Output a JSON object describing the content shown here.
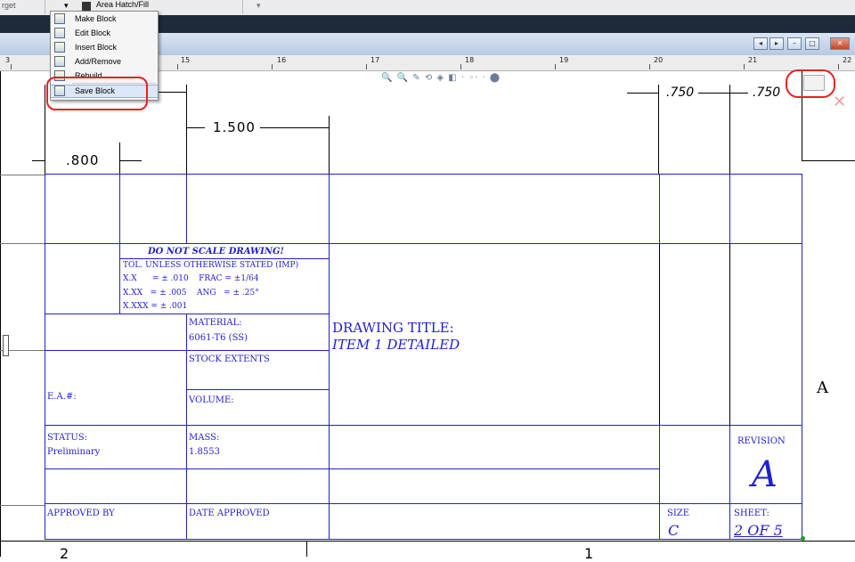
{
  "toolbar": {
    "left_label": "rget",
    "area_hatch": "Area Hatch/Fill",
    "sep_glyph": "▾"
  },
  "window_buttons": {
    "b1": "◂",
    "b2": "▸",
    "min": "–",
    "max": "□",
    "close": "✕"
  },
  "ruler": {
    "numbers": [
      "15",
      "16",
      "17",
      "18",
      "19",
      "20",
      "21",
      "22"
    ],
    "left_num": "3"
  },
  "menu": {
    "items": [
      {
        "label": "Make Block",
        "icon": "make-block-icon"
      },
      {
        "label": "Edit Block",
        "icon": "edit-block-icon"
      },
      {
        "label": "Insert Block",
        "icon": "insert-block-icon"
      },
      {
        "label": "Add/Remove",
        "icon": "add-remove-icon"
      },
      {
        "label": "Rebuild",
        "icon": "rebuild-icon"
      },
      {
        "label": "Save Block",
        "icon": "save-block-icon"
      }
    ]
  },
  "view_toolbar": "🔍 🔍 ✎ ⟲ ◈ ◧ · ◦· · ⬤",
  "dims": {
    "d750a": ".750",
    "d750b": ".750",
    "d1500": "1.500",
    "d800": ".800"
  },
  "title_block": {
    "no_scale": "DO NOT SCALE DRAWING!",
    "tol_line1": "TOL. UNLESS OTHERWISE STATED (IMP)",
    "tol_line2": "X.X      = ± .010    FRAC = ±1/64",
    "tol_line3": "X.XX   = ± .005    ANG   = ± .25°",
    "tol_line4": "X.XXX = ± .001",
    "material_label": "MATERIAL:",
    "material_value": "6061-T6 (SS)",
    "stock_label": "STOCK EXTENTS",
    "drawing_title_label": "DRAWING TITLE:",
    "drawing_title_value": "ITEM 1 DETAILED",
    "ea_label": "E.A.#:",
    "volume_label": "VOLUME:",
    "status_label": "STATUS:",
    "status_value": "Preliminary",
    "mass_label": "MASS:",
    "mass_value": "1.8553",
    "revision_label": "REVISION",
    "revision_value": "A",
    "approved_by": "APPROVED BY",
    "date_approved": "DATE APPROVED",
    "size_label": "SIZE",
    "size_value": "C",
    "sheet_label": "SHEET:",
    "sheet_value": "2 OF 5",
    "zone_letter": "A"
  },
  "bottom_numbers": {
    "left": "2",
    "right": "1"
  },
  "colors": {
    "line": "#1f1fd0",
    "annotation": "#e52222"
  }
}
